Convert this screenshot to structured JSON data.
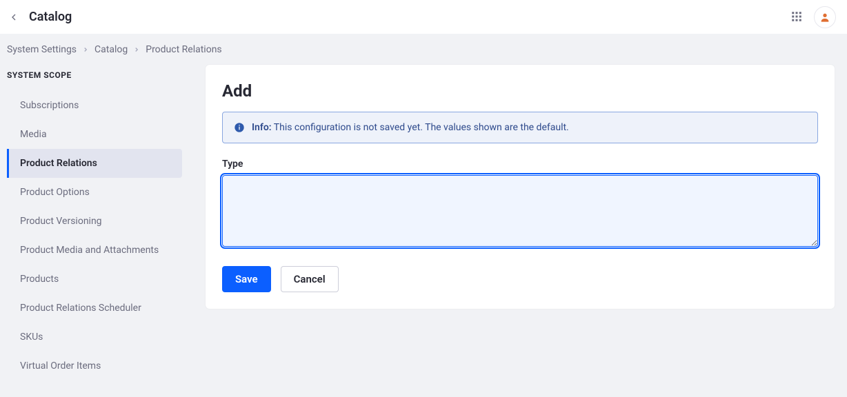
{
  "header": {
    "title": "Catalog"
  },
  "breadcrumb": {
    "items": [
      "System Settings",
      "Catalog",
      "Product Relations"
    ]
  },
  "sidebar": {
    "heading": "SYSTEM SCOPE",
    "items": [
      {
        "label": "Subscriptions",
        "active": false
      },
      {
        "label": "Media",
        "active": false
      },
      {
        "label": "Product Relations",
        "active": true
      },
      {
        "label": "Product Options",
        "active": false
      },
      {
        "label": "Product Versioning",
        "active": false
      },
      {
        "label": "Product Media and Attachments",
        "active": false
      },
      {
        "label": "Products",
        "active": false
      },
      {
        "label": "Product Relations Scheduler",
        "active": false
      },
      {
        "label": "SKUs",
        "active": false
      },
      {
        "label": "Virtual Order Items",
        "active": false
      }
    ]
  },
  "page": {
    "title": "Add",
    "alert": {
      "label": "Info:",
      "text": "This configuration is not saved yet. The values shown are the default."
    },
    "form": {
      "type_label": "Type",
      "type_value": ""
    },
    "actions": {
      "save": "Save",
      "cancel": "Cancel"
    }
  }
}
